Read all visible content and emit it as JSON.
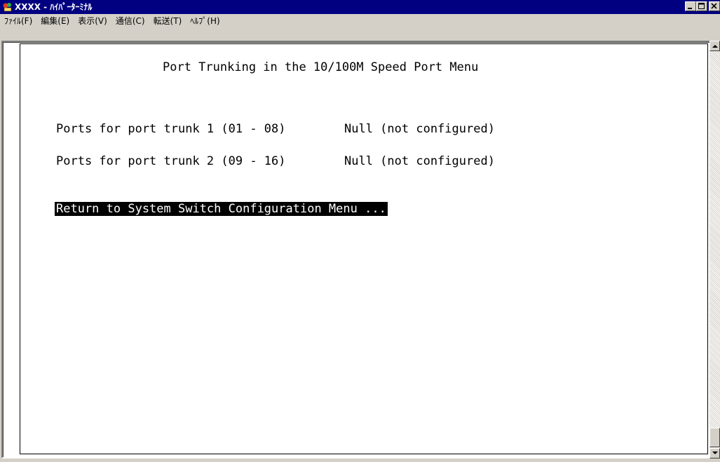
{
  "window": {
    "title": "XXXX - ﾊｲﾊﾟｰﾀｰﾐﾅﾙ",
    "icon": "hyperterminal-icon"
  },
  "menu": {
    "items": [
      {
        "label": "ﾌｧｲﾙ(F)"
      },
      {
        "label": "編集(E)"
      },
      {
        "label": "表示(V)"
      },
      {
        "label": "通信(C)"
      },
      {
        "label": "転送(T)"
      },
      {
        "label": "ﾍﾙﾌﾟ(H)"
      }
    ]
  },
  "terminal": {
    "title": "Port Trunking in the 10/100M Speed Port Menu",
    "rows": [
      {
        "label": "Ports for port trunk 1 (01 - 08)",
        "value": "Null (not configured)"
      },
      {
        "label": "Ports for port trunk 2 (09 - 16)",
        "value": "Null (not configured)"
      }
    ],
    "return_item": "Return to System Switch Configuration Menu ..."
  },
  "colors": {
    "titlebar": "#000080",
    "chrome": "#d4d0c8",
    "terminal_bg": "#ffffff",
    "terminal_fg": "#000000",
    "selection_bg": "#000000",
    "selection_fg": "#ffffff"
  }
}
